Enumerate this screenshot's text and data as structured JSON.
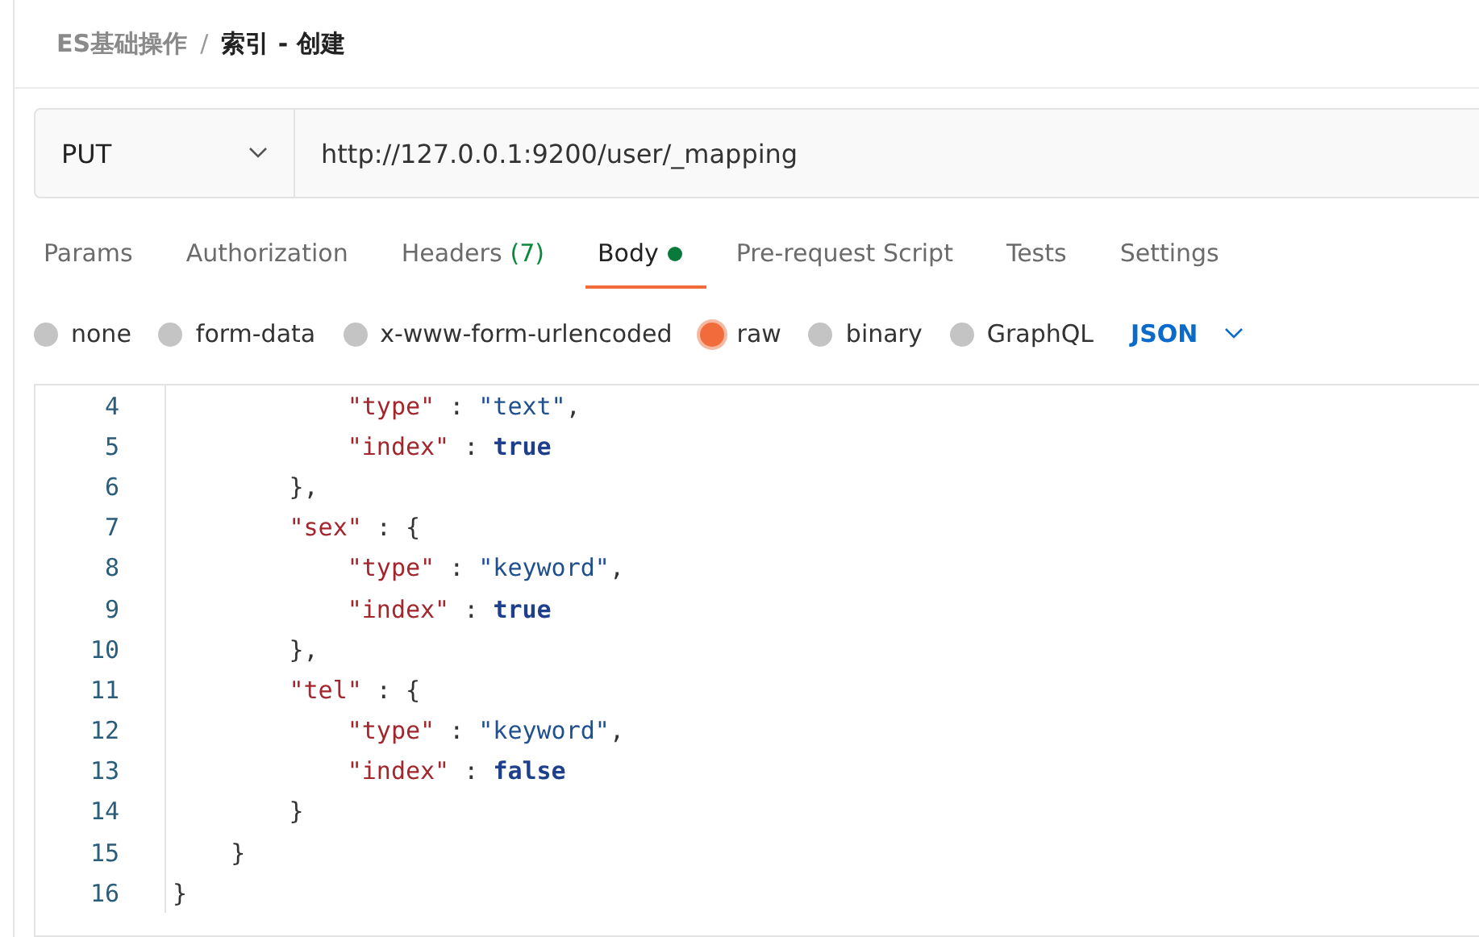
{
  "breadcrumb": {
    "parent": "ES基础操作",
    "separator": "/",
    "current": "索引 - 创建"
  },
  "request": {
    "method": "PUT",
    "url": "http://127.0.0.1:9200/user/_mapping"
  },
  "tabs": [
    {
      "label": "Params",
      "selected": false
    },
    {
      "label": "Authorization",
      "selected": false
    },
    {
      "label": "Headers",
      "count": "(7)",
      "selected": false
    },
    {
      "label": "Body",
      "selected": true,
      "dot": true
    },
    {
      "label": "Pre-request Script",
      "selected": false
    },
    {
      "label": "Tests",
      "selected": false
    },
    {
      "label": "Settings",
      "selected": false
    }
  ],
  "body_types": [
    {
      "label": "none",
      "selected": false
    },
    {
      "label": "form-data",
      "selected": false
    },
    {
      "label": "x-www-form-urlencoded",
      "selected": false
    },
    {
      "label": "raw",
      "selected": true
    },
    {
      "label": "binary",
      "selected": false
    },
    {
      "label": "GraphQL",
      "selected": false
    }
  ],
  "format": "JSON",
  "editor": {
    "lines": [
      {
        "number": "4",
        "code": "            \"type\" : \"text\","
      },
      {
        "number": "5",
        "code": "            \"index\" : true"
      },
      {
        "number": "6",
        "code": "        },"
      },
      {
        "number": "7",
        "code": "        \"sex\" : {"
      },
      {
        "number": "8",
        "code": "            \"type\" : \"keyword\","
      },
      {
        "number": "9",
        "code": "            \"index\" : true"
      },
      {
        "number": "10",
        "code": "        },"
      },
      {
        "number": "11",
        "code": "        \"tel\" : {"
      },
      {
        "number": "12",
        "code": "            \"type\" : \"keyword\","
      },
      {
        "number": "13",
        "code": "            \"index\" : false"
      },
      {
        "number": "14",
        "code": "        }"
      },
      {
        "number": "15",
        "code": "    }"
      },
      {
        "number": "16",
        "code": "}"
      }
    ]
  }
}
